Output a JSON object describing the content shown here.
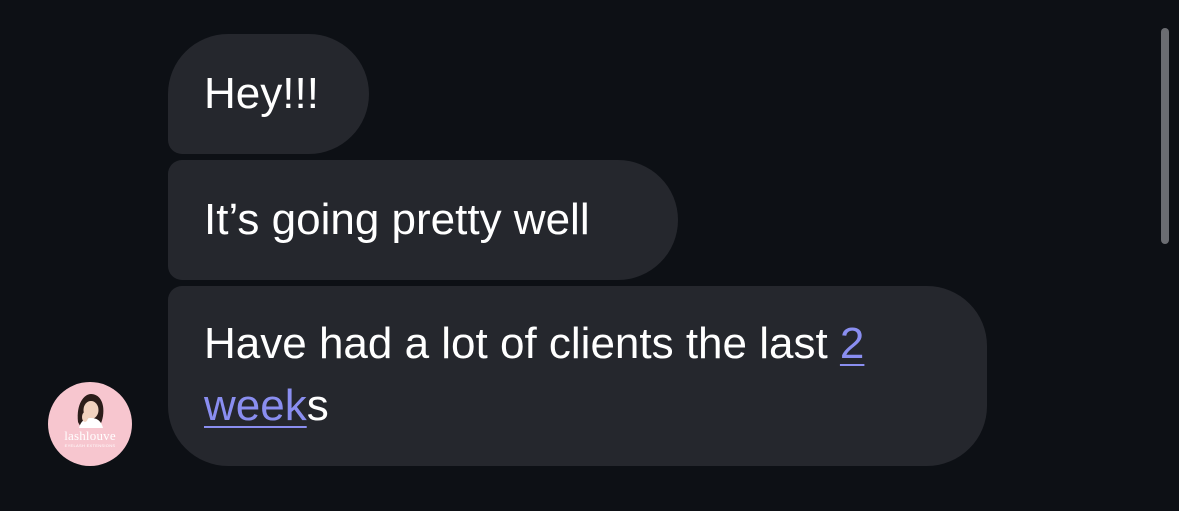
{
  "messages": [
    {
      "text": "Hey!!!"
    },
    {
      "text": "It’s going pretty well"
    },
    {
      "text_before": "Have had a lot of clients the last ",
      "link_text_line1": "2",
      "link_text_line2": "week",
      "text_after": "s"
    }
  ],
  "avatar": {
    "brand": "lashlouve",
    "subtitle": "EYELASH EXTENSIONS"
  },
  "colors": {
    "background": "#0d1015",
    "bubble": "#25272d",
    "text": "#ffffff",
    "link": "#8a8ef0",
    "avatar_bg": "#f7c6cf"
  }
}
